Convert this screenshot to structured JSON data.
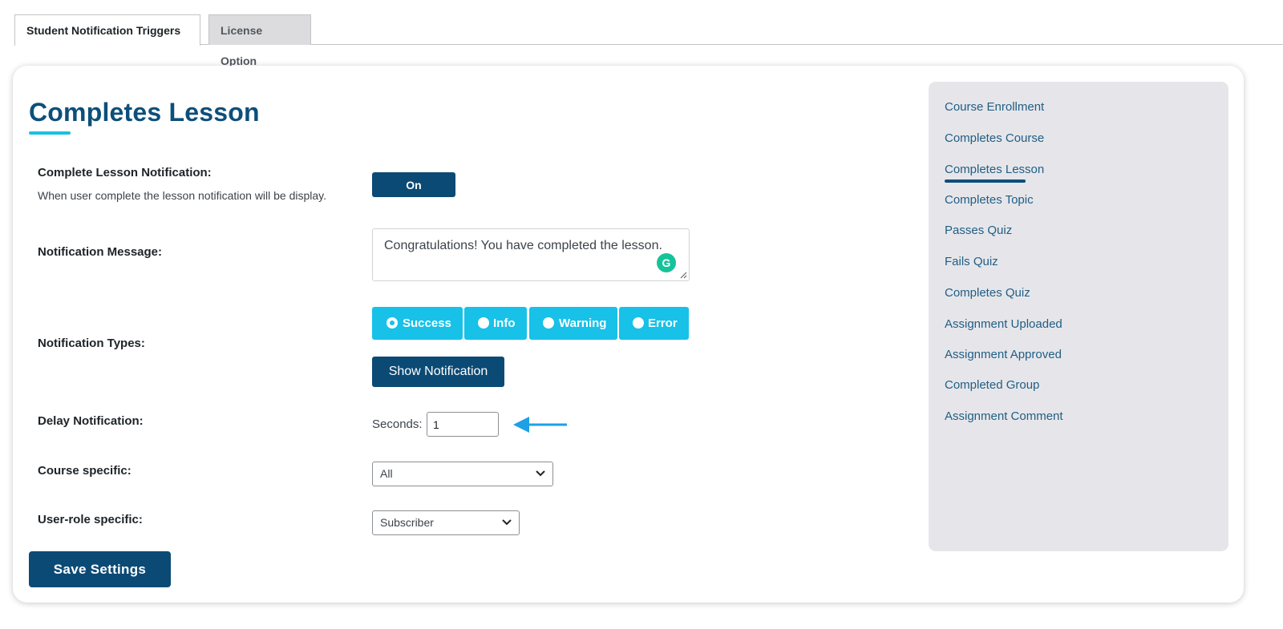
{
  "tabs": [
    {
      "label": "Student Notification Triggers",
      "active": true
    },
    {
      "label": "License Option",
      "active": false
    }
  ],
  "page_title": "Completes Lesson",
  "fields": {
    "lesson_notification": {
      "label": "Complete Lesson Notification:",
      "description": "When user complete the lesson notification will be display.",
      "toggle_label": "On"
    },
    "message": {
      "label": "Notification Message:",
      "value": "Congratulations! You have completed the lesson."
    },
    "types": {
      "label": "Notification Types:",
      "options": [
        "Success",
        "Info",
        "Warning",
        "Error"
      ],
      "selected": "Success",
      "show_button": "Show Notification"
    },
    "delay": {
      "label": "Delay Notification:",
      "seconds_label": "Seconds:",
      "value": "1"
    },
    "course": {
      "label": "Course specific:",
      "selected": "All"
    },
    "role": {
      "label": "User-role specific:",
      "selected": "Subscriber"
    }
  },
  "save_label": "Save Settings",
  "sidebar": {
    "items": [
      "Course Enrollment",
      "Completes Course",
      "Completes Lesson",
      "Completes Topic",
      "Passes Quiz",
      "Fails Quiz",
      "Completes Quiz",
      "Assignment Uploaded",
      "Assignment Approved",
      "Completed Group",
      "Assignment Comment"
    ],
    "active": "Completes Lesson"
  },
  "icons": {
    "grammarly": "grammarly-icon",
    "arrow": "arrow-left-icon",
    "dropdown": "chevron-down-icon"
  },
  "colors": {
    "primary": "#0b4a75",
    "accent": "#17c1e8",
    "title": "#0d4f7a",
    "sidebar_bg": "#e6e6ea",
    "sidebar_link": "#215e85",
    "arrow": "#1ea0e6"
  }
}
